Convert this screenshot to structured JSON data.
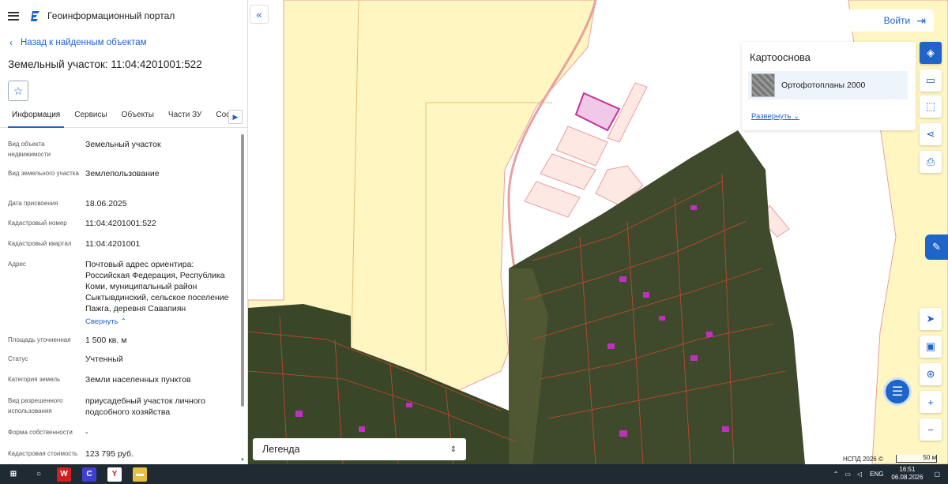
{
  "header": {
    "app_title": "Геоинформационный портал"
  },
  "panel": {
    "back_label": "Назад к найденным объектам",
    "title": "Земельный участок: 11:04:4201001:522",
    "tabs": [
      "Информация",
      "Сервисы",
      "Объекты",
      "Части ЗУ",
      "Состав"
    ],
    "fields": [
      {
        "label": "Вид объекта недвижимости",
        "value": "Земельный участок"
      },
      {
        "label": "Вид земельного участка",
        "value": "Землепользование"
      },
      {
        "label": "Дата присвоения",
        "value": "18.06.2025"
      },
      {
        "label": "Кадастровый номер",
        "value": "11:04:4201001:522"
      },
      {
        "label": "Кадастровый квартал",
        "value": "11:04:4201001"
      },
      {
        "label": "Адрес",
        "value": "Почтовый адрес ориентира: Российская Федерация, Республика Коми, муниципальный район Сыктывдинский, сельское поселение Пажга, деревня Савапиян"
      },
      {
        "label": "Площадь уточненная",
        "value": "1 500 кв. м"
      },
      {
        "label": "Статус",
        "value": "Учтенный"
      },
      {
        "label": "Категория земель",
        "value": "Земли населенных пунктов"
      },
      {
        "label": "Вид разрешенного использования",
        "value": "приусадебный участок личного подсобного хозяйства"
      },
      {
        "label": "Форма собственности",
        "value": "-"
      },
      {
        "label": "Кадастровая стоимость",
        "value": "123 795 руб."
      }
    ],
    "collapse_label": "Свернуть"
  },
  "map": {
    "login_label": "Войти",
    "basemap": {
      "title": "Картооснова",
      "item": "Ортофотопланы 2000",
      "expand_label": "Развернуть"
    },
    "legend_label": "Легенда",
    "attribution": "НСПД 2026 ©",
    "scale_label": "50 м",
    "tools": [
      "layers-icon",
      "ruler-icon",
      "select-area-icon",
      "share-icon",
      "print-icon",
      "location-icon",
      "basemap-icon",
      "geo-search-icon",
      "zoom-in-icon",
      "zoom-out-icon"
    ],
    "colors": {
      "accent": "#1f64c8",
      "parcel_fill": "#fff6c2",
      "parcel_stroke": "#e8a0a0",
      "selected": "#c0359a"
    }
  },
  "taskbar": {
    "lang": "ENG",
    "time": "16:51",
    "date": "06.08.2026"
  }
}
